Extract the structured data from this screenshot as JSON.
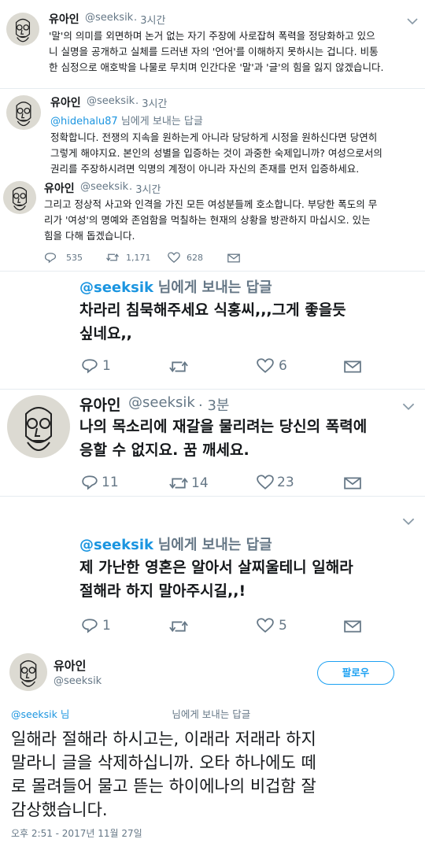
{
  "t1": {
    "name": "유아인",
    "handle": "@seeksik",
    "time": "· 3시간",
    "lines": [
      "'말'의 의미를 외면하며 논거 없는 자기 주장에 사로잡혀 폭력을 정당화하고 있으",
      "니 실명을 공개하고 실체를 드러낸 자의 '언어'를 이해하지 못하시는 겁니다. 비통",
      "한 심정으로 애호박을 나물로 무치며 인간다운 '말'과 '글'의 힘을 잃지 않겠습니다."
    ]
  },
  "t2": {
    "name": "유아인",
    "handle": "@seeksik",
    "time": "· 3시간",
    "reply_handle": "@hidehalu87",
    "reply_suffix": "님에게 보내는 답글",
    "lines": [
      "정확합니다. 전쟁의 지속을 원하는게 아니라 당당하게 시정을 원하신다면 당연히",
      "그렇게 해야지요. 본인의 성별을 입증하는 것이 과중한 숙제입니까? 여성으로서의",
      "권리를 주장하시려면 익명의 계정이 아니라 자신의 존재를 먼저 입증하세요."
    ]
  },
  "t3": {
    "name": "유아인",
    "handle": "@seeksik",
    "time": "· 3시간",
    "lines": [
      "그리고 정상적 사고와 인격을 가진 모든 여성분들께 호소합니다. 부당한 폭도의 무",
      "리가 '여성'의 명예와 존엄함을 먹칠하는 현재의 상황을 방관하지 마십시오. 있는",
      "힘을 다해 돕겠습니다."
    ],
    "replies": "535",
    "retweets": "1,171",
    "likes": "628"
  },
  "t4": {
    "reply_handle": "@seeksik",
    "reply_suffix": "님에게 보내는 답글",
    "lines": [
      "차라리 침묵해주세요 식홍씨,,,그게 좋을듯",
      "싶네요,,"
    ],
    "replies": "1",
    "retweets": "",
    "likes": "6"
  },
  "t5": {
    "name": "유아인",
    "handle": "@seeksik",
    "time": "· 3분",
    "lines": [
      "나의 목소리에 재갈을 물리려는 당신의 폭력에",
      "응할 수 없지요. 꿈 깨세요."
    ],
    "replies": "11",
    "retweets": "14",
    "likes": "23"
  },
  "t6": {
    "reply_handle": "@seeksik",
    "reply_suffix": "님에게 보내는 답글",
    "lines": [
      "제 가난한 영혼은 알아서 살찌울테니 일해라",
      "절해라 하지 말아주시길,,!"
    ],
    "replies": "1",
    "retweets": "",
    "likes": "5"
  },
  "t7": {
    "name": "유아인",
    "handle": "@seeksik",
    "follow": "팔로우",
    "reply_prefix": "@seeksik 님",
    "reply_suffix": "님에게 보내는 답글",
    "lines": [
      "일해라 절해라 하시고는, 이래라 저래라 하지",
      "말라니 글을 삭제하십니까. 오타 하나에도 떼",
      "로 몰려들어 물고 뜯는 하이에나의 비겁함 잘",
      "감상했습니다."
    ],
    "date": "오후 2:51 - 2017년 11월 27일"
  },
  "colors": {
    "link": "#1b95e0",
    "gray": "#657786",
    "follow": "#1da1f2"
  }
}
